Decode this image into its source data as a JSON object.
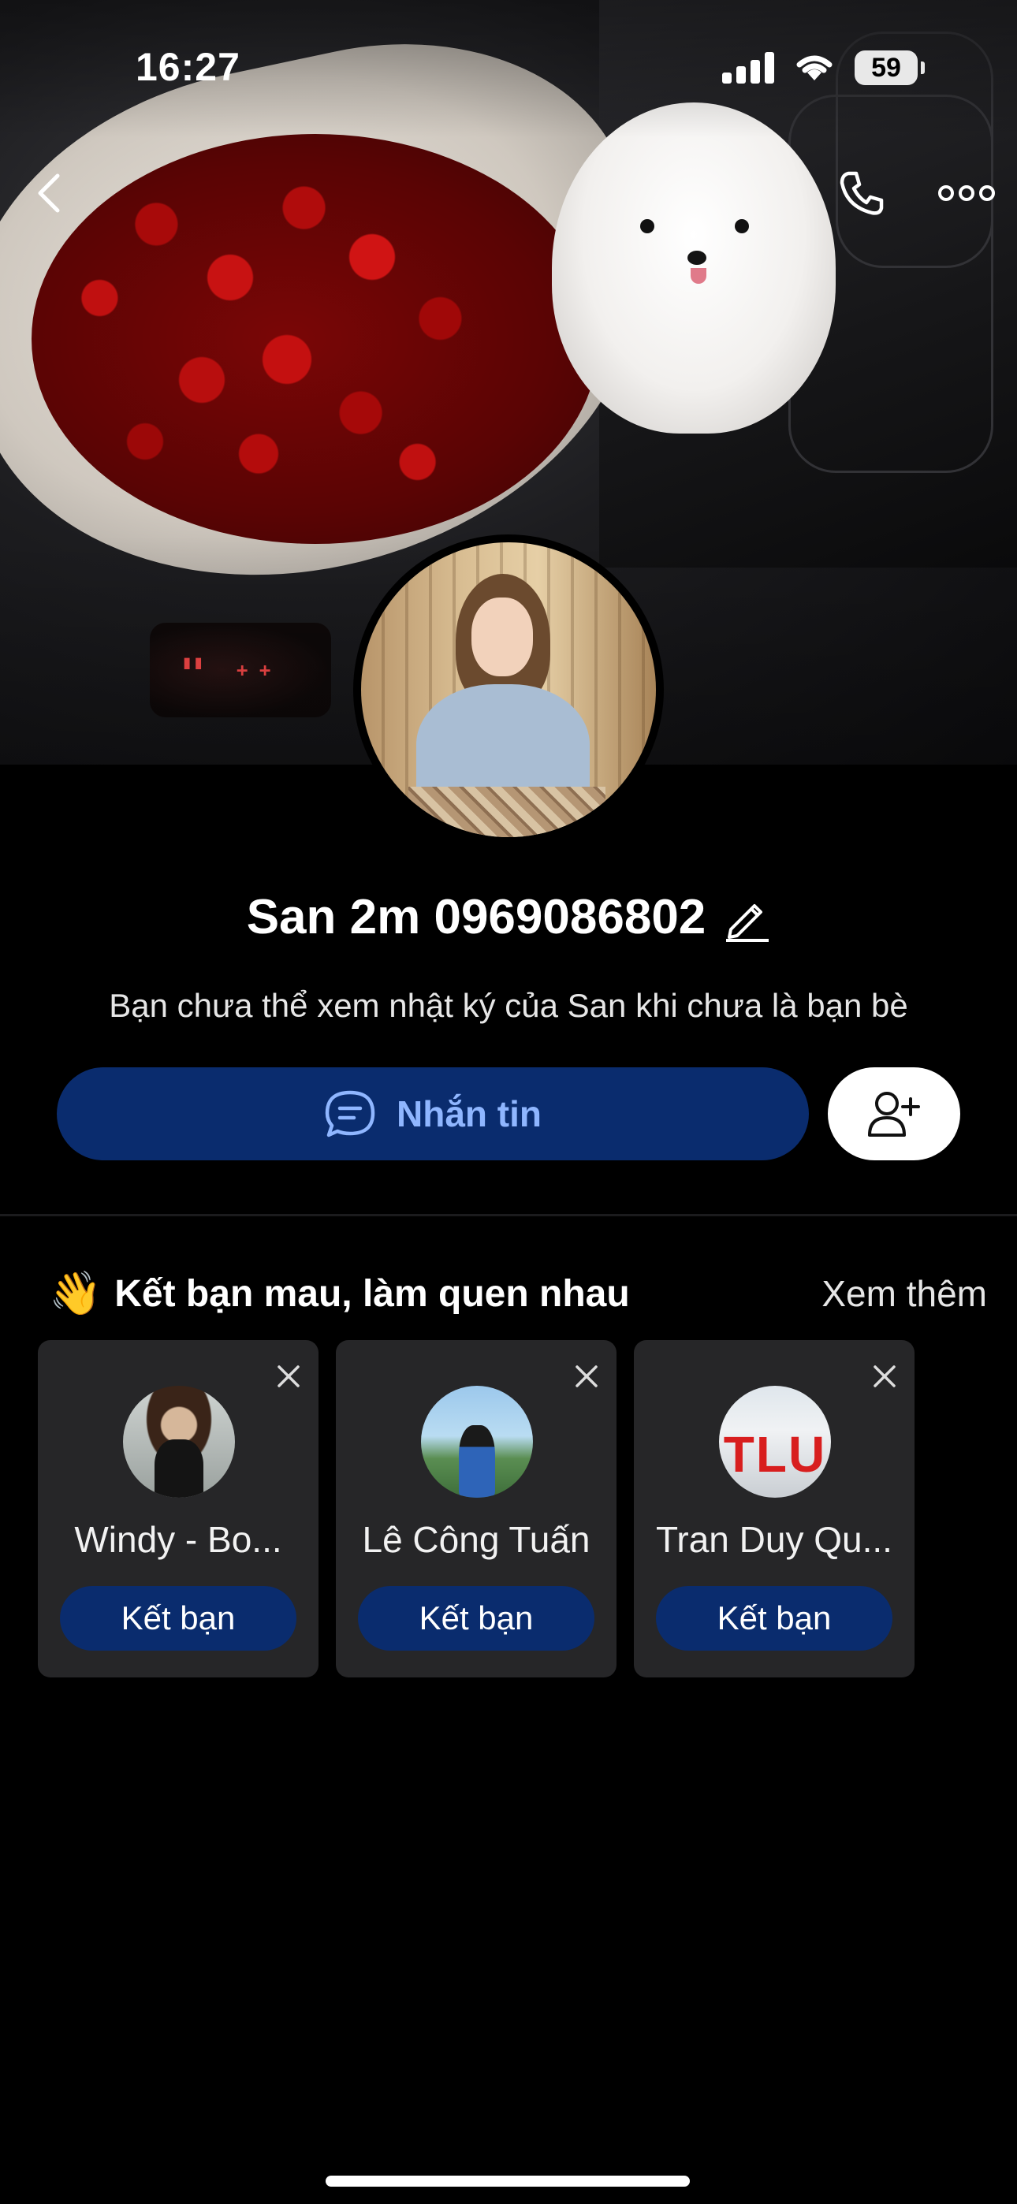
{
  "status_bar": {
    "time": "16:27",
    "battery": "59"
  },
  "profile": {
    "name": "San 2m 0969086802",
    "subtitle": "Bạn chưa thể xem nhật ký của San khi chưa là bạn bè"
  },
  "actions": {
    "message_label": "Nhắn tin"
  },
  "suggestions": {
    "title": "Kết bạn mau, làm quen nhau",
    "emoji": "👋",
    "see_more": "Xem thêm",
    "cards": [
      {
        "name": "Windy - Bo...",
        "button": "Kết bạn"
      },
      {
        "name": "Lê Công Tuấn",
        "button": "Kết bạn"
      },
      {
        "name": "Tran Duy Qu...",
        "button": "Kết bạn"
      }
    ],
    "card3_photo_text": "TLU"
  },
  "colors": {
    "primary_button": "#0a2c6e",
    "primary_text": "#8fb6ff",
    "card_bg": "#262628",
    "background": "#000000"
  },
  "icons": [
    "back-arrow-icon",
    "phone-icon",
    "more-options-icon",
    "edit-pencil-icon",
    "chat-bubble-icon",
    "add-friend-icon",
    "close-icon"
  ]
}
